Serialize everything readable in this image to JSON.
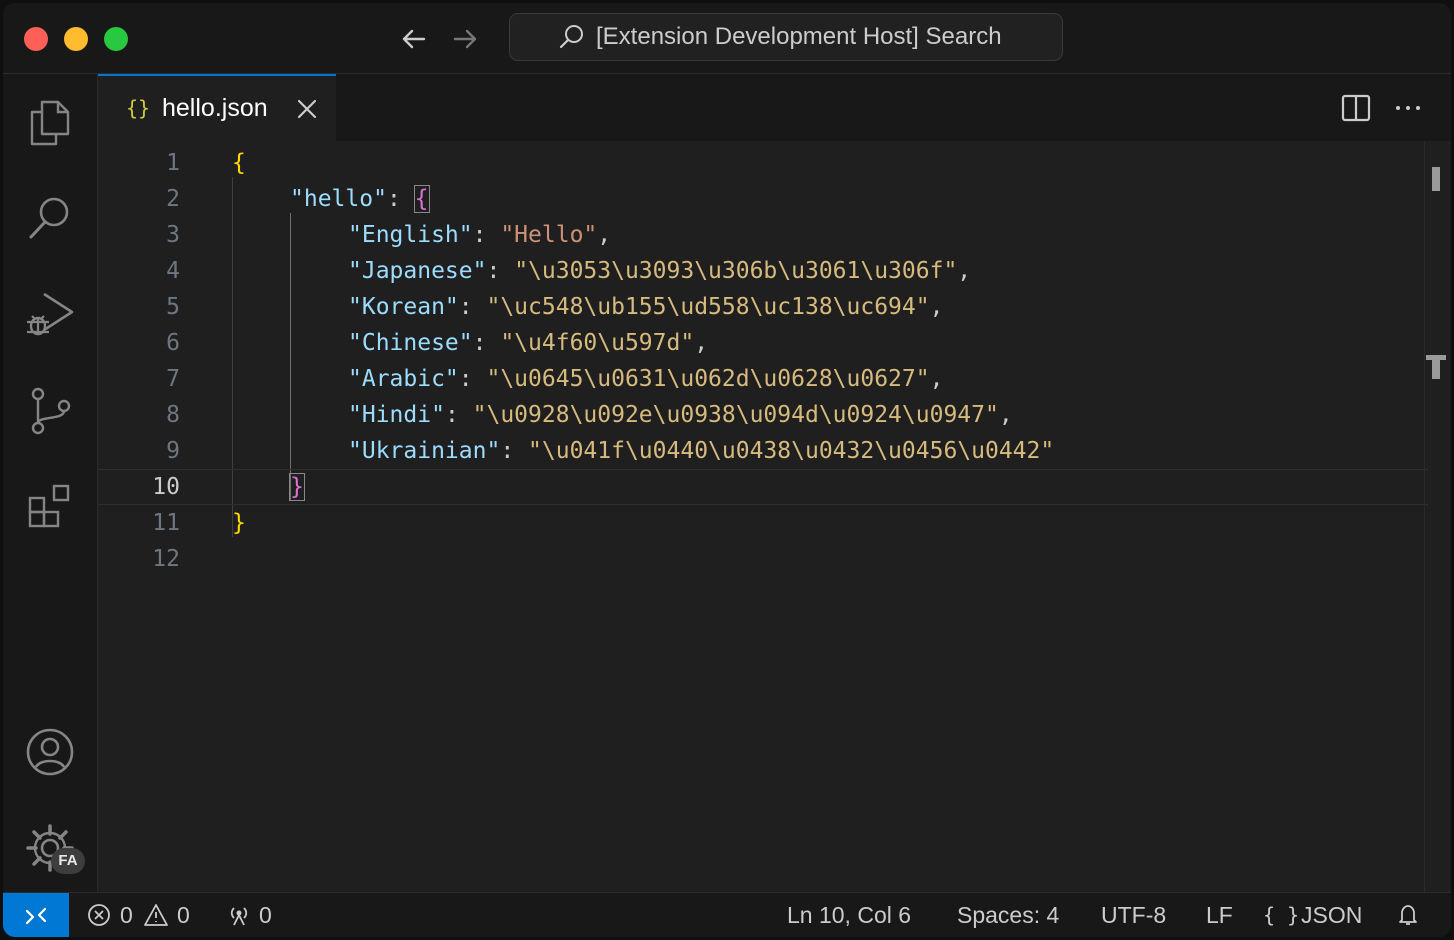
{
  "window": {
    "search_text": "[Extension Development Host] Search"
  },
  "activity_bar": {
    "items": [
      "files-icon",
      "search-icon",
      "run-debug-icon",
      "source-control-icon",
      "extensions-icon",
      "account-icon",
      "manage-gear-icon"
    ],
    "manage_badge": "FA"
  },
  "tab": {
    "icon_text": "{}",
    "label": "hello.json"
  },
  "editor": {
    "current_line": 10,
    "lines": [
      {
        "number": "1"
      },
      {
        "number": "2"
      },
      {
        "number": "3"
      },
      {
        "number": "4"
      },
      {
        "number": "5"
      },
      {
        "number": "6"
      },
      {
        "number": "7"
      },
      {
        "number": "8"
      },
      {
        "number": "9"
      },
      {
        "number": "10"
      },
      {
        "number": "11"
      },
      {
        "number": "12"
      }
    ],
    "tokens": {
      "open_root": "{",
      "key_hello": "\"hello\"",
      "colon": ": ",
      "open_hello": "{",
      "entries": [
        {
          "key": "\"English\"",
          "value": "\"Hello\"",
          "comma": ","
        },
        {
          "key": "\"Japanese\"",
          "value": "\"\\u3053\\u3093\\u306b\\u3061\\u306f\"",
          "comma": ","
        },
        {
          "key": "\"Korean\"",
          "value": "\"\\uc548\\ub155\\ud558\\uc138\\uc694\"",
          "comma": ","
        },
        {
          "key": "\"Chinese\"",
          "value": "\"\\u4f60\\u597d\"",
          "comma": ","
        },
        {
          "key": "\"Arabic\"",
          "value": "\"\\u0645\\u0631\\u062d\\u0628\\u0627\"",
          "comma": ","
        },
        {
          "key": "\"Hindi\"",
          "value": "\"\\u0928\\u092e\\u0938\\u094d\\u0924\\u0947\"",
          "comma": ","
        },
        {
          "key": "\"Ukrainian\"",
          "value": "\"\\u041f\\u0440\\u0438\\u0432\\u0456\\u0442\"",
          "comma": ""
        }
      ],
      "close_hello": "}",
      "close_root": "}"
    }
  },
  "status_bar": {
    "errors": "0",
    "warnings": "0",
    "ports": "0",
    "cursor": "Ln 10, Col 6",
    "indent": "Spaces: 4",
    "encoding": "UTF-8",
    "eol": "LF",
    "language_icon": "{ }",
    "language": "JSON"
  },
  "colors": {
    "accent": "#0078d4",
    "key": "#9cdcfe",
    "string": "#ce9178",
    "bracket_level1": "#ffd700",
    "bracket_level2": "#da70d6"
  }
}
